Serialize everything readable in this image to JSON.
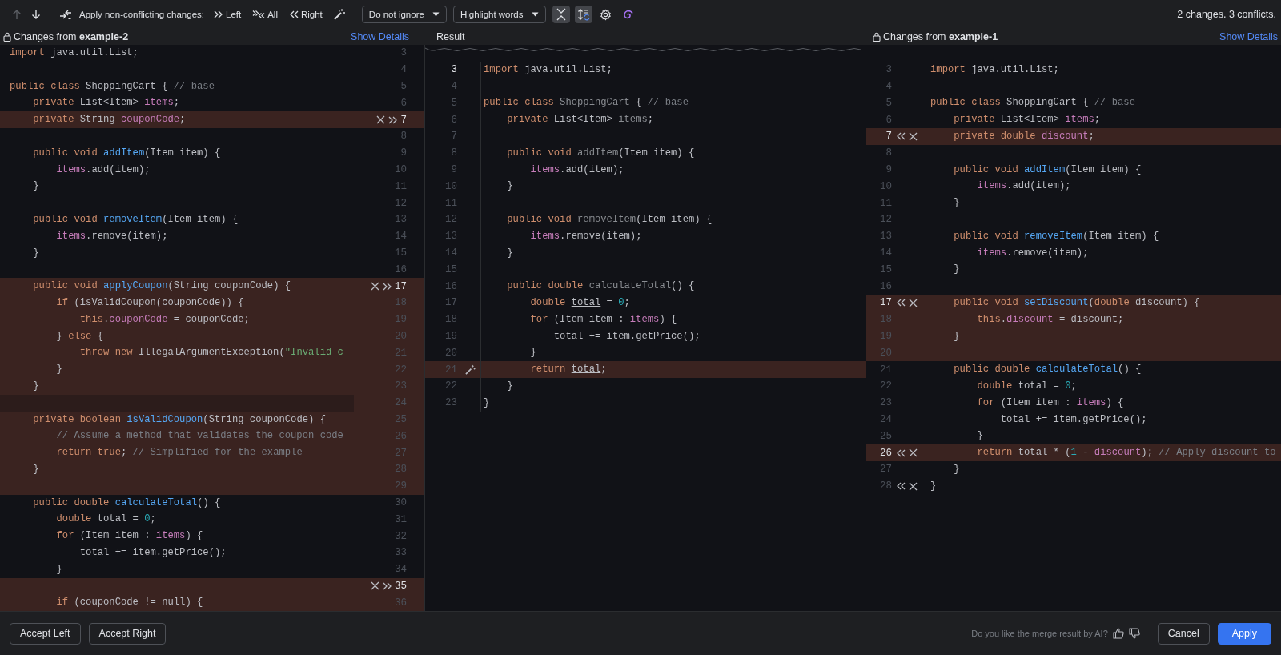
{
  "toolbar": {
    "nav": [
      {
        "kind": "up",
        "disabled": true
      },
      {
        "kind": "down",
        "disabled": false
      }
    ],
    "apply_label": "Apply non-conflicting changes:",
    "apply_actions": [
      {
        "kind": "left",
        "label": "Left"
      },
      {
        "kind": "all",
        "label": "All"
      },
      {
        "kind": "right",
        "label": "Right"
      }
    ],
    "dropdowns": [
      {
        "value": "Do not ignore"
      },
      {
        "value": "Highlight words"
      }
    ],
    "toggles": [
      {
        "kind": "collapse",
        "on": true
      },
      {
        "kind": "sync",
        "on": true
      }
    ],
    "summary": "2 changes. 3 conflicts."
  },
  "left": {
    "title": "Changes from",
    "branch": "example-2",
    "details": "Show Details",
    "lines": [
      {
        "n": "3",
        "changed": false,
        "code": [
          {
            "text": "import ",
            "kind": "kw"
          },
          {
            "text": "java.util.List;",
            "kind": "p"
          }
        ]
      },
      {
        "n": "4",
        "changed": false
      },
      {
        "n": "5",
        "changed": false,
        "code": [
          {
            "text": "public class ",
            "kind": "kw"
          },
          {
            "text": "ShoppingCart { ",
            "kind": "p"
          },
          {
            "text": "// base",
            "kind": "c"
          }
        ]
      },
      {
        "n": "6",
        "changed": false,
        "code": [
          {
            "text": "    private ",
            "kind": "kw"
          },
          {
            "text": "List<Item> ",
            "kind": "p"
          },
          {
            "text": "items",
            "kind": "f"
          },
          {
            "text": ";",
            "kind": "p"
          }
        ]
      },
      {
        "n": "7",
        "changed": true,
        "kind": "actions",
        "code": [
          {
            "text": "    private ",
            "kind": "kw"
          },
          {
            "text": "String ",
            "kind": "p"
          },
          {
            "text": "couponCode",
            "kind": "f"
          },
          {
            "text": ";",
            "kind": "p"
          }
        ]
      },
      {
        "n": "8",
        "changed": false
      },
      {
        "n": "9",
        "changed": false,
        "code": [
          {
            "text": "    public void ",
            "kind": "kw"
          },
          {
            "text": "addItem",
            "kind": "fn"
          },
          {
            "text": "(Item item) {",
            "kind": "p"
          }
        ]
      },
      {
        "n": "10",
        "changed": false,
        "code": [
          {
            "text": "        items",
            "kind": "f"
          },
          {
            "text": ".add(item);",
            "kind": "p"
          }
        ]
      },
      {
        "n": "11",
        "changed": false,
        "code": [
          {
            "text": "    }",
            "kind": "p"
          }
        ]
      },
      {
        "n": "12",
        "changed": false
      },
      {
        "n": "13",
        "changed": false,
        "code": [
          {
            "text": "    public void ",
            "kind": "kw"
          },
          {
            "text": "removeItem",
            "kind": "fn"
          },
          {
            "text": "(Item item) {",
            "kind": "p"
          }
        ]
      },
      {
        "n": "14",
        "changed": false,
        "code": [
          {
            "text": "        items",
            "kind": "f"
          },
          {
            "text": ".remove(item);",
            "kind": "p"
          }
        ]
      },
      {
        "n": "15",
        "changed": false,
        "code": [
          {
            "text": "    }",
            "kind": "p"
          }
        ]
      },
      {
        "n": "16",
        "changed": false
      },
      {
        "n": "17",
        "changed": true,
        "kind": "actions",
        "code": [
          {
            "text": "    public void ",
            "kind": "kw"
          },
          {
            "text": "applyCoupon",
            "kind": "fn"
          },
          {
            "text": "(String couponCode) {",
            "kind": "p"
          }
        ]
      },
      {
        "n": "18",
        "changed": true,
        "code": [
          {
            "text": "        if ",
            "kind": "kw"
          },
          {
            "text": "(isValidCoupon(couponCode)) {",
            "kind": "p"
          }
        ]
      },
      {
        "n": "19",
        "changed": true,
        "code": [
          {
            "text": "            this",
            "kind": "kw"
          },
          {
            "text": ".",
            "kind": "p"
          },
          {
            "text": "couponCode",
            "kind": "f"
          },
          {
            "text": " = couponCode;",
            "kind": "p"
          }
        ]
      },
      {
        "n": "20",
        "changed": true,
        "code": [
          {
            "text": "        } ",
            "kind": "p"
          },
          {
            "text": "else",
            "kind": "kw"
          },
          {
            "text": " {",
            "kind": "p"
          }
        ]
      },
      {
        "n": "21",
        "changed": true,
        "code": [
          {
            "text": "            throw new ",
            "kind": "kw"
          },
          {
            "text": "IllegalArgumentException(",
            "kind": "p"
          },
          {
            "text": "\"Invalid c",
            "kind": "s"
          }
        ]
      },
      {
        "n": "22",
        "changed": true,
        "code": [
          {
            "text": "        }",
            "kind": "p"
          }
        ]
      },
      {
        "n": "23",
        "changed": true,
        "code": [
          {
            "text": "    }",
            "kind": "p"
          }
        ]
      },
      {
        "n": "24",
        "changed": true
      },
      {
        "n": "25",
        "changed": true,
        "code": [
          {
            "text": "    private boolean ",
            "kind": "kw"
          },
          {
            "text": "isValidCoupon",
            "kind": "fn"
          },
          {
            "text": "(String couponCode) {",
            "kind": "p"
          }
        ]
      },
      {
        "n": "26",
        "changed": true,
        "code": [
          {
            "text": "        // Assume a method that validates the coupon code",
            "kind": "c"
          }
        ]
      },
      {
        "n": "27",
        "changed": true,
        "code": [
          {
            "text": "        return true",
            "kind": "kw"
          },
          {
            "text": "; ",
            "kind": "p"
          },
          {
            "text": "// Simplified for the example",
            "kind": "c"
          }
        ]
      },
      {
        "n": "28",
        "changed": true,
        "code": [
          {
            "text": "    }",
            "kind": "p"
          }
        ]
      },
      {
        "n": "29",
        "changed": true
      },
      {
        "n": "30",
        "changed": false,
        "code": [
          {
            "text": "    public double ",
            "kind": "kw"
          },
          {
            "text": "calculateTotal",
            "kind": "fn"
          },
          {
            "text": "() {",
            "kind": "p"
          }
        ]
      },
      {
        "n": "31",
        "changed": false,
        "code": [
          {
            "text": "        double ",
            "kind": "kw"
          },
          {
            "text": "total = ",
            "kind": "p"
          },
          {
            "text": "0",
            "kind": "n"
          },
          {
            "text": ";",
            "kind": "p"
          }
        ]
      },
      {
        "n": "32",
        "changed": false,
        "code": [
          {
            "text": "        for ",
            "kind": "kw"
          },
          {
            "text": "(Item item : ",
            "kind": "p"
          },
          {
            "text": "items",
            "kind": "f"
          },
          {
            "text": ") {",
            "kind": "p"
          }
        ]
      },
      {
        "n": "33",
        "changed": false,
        "code": [
          {
            "text": "            total += item.getPrice();",
            "kind": "p"
          }
        ]
      },
      {
        "n": "34",
        "changed": false,
        "code": [
          {
            "text": "        }",
            "kind": "p"
          }
        ]
      },
      {
        "n": "35",
        "changed": true,
        "kind": "actions"
      },
      {
        "n": "36",
        "changed": true,
        "code": [
          {
            "text": "        if ",
            "kind": "kw"
          },
          {
            "text": "(couponCode != null) {",
            "kind": "p"
          }
        ]
      }
    ]
  },
  "result": {
    "title": "Result",
    "lines": [
      {
        "n": "3",
        "changed": false,
        "code": [
          {
            "text": "import ",
            "kind": "kw"
          },
          {
            "text": "java.util.List;",
            "kind": "p"
          }
        ]
      },
      {
        "n": "4",
        "changed": false
      },
      {
        "n": "5",
        "changed": false,
        "code": [
          {
            "text": "public class ",
            "kind": "kw"
          },
          {
            "text": "ShoppingCart",
            "kind": "d"
          },
          {
            "text": " { ",
            "kind": "p"
          },
          {
            "text": "// base",
            "kind": "c"
          }
        ]
      },
      {
        "n": "6",
        "changed": false,
        "code": [
          {
            "text": "    private ",
            "kind": "kw"
          },
          {
            "text": "List<Item> ",
            "kind": "p"
          },
          {
            "text": "items",
            "kind": "d"
          },
          {
            "text": ";",
            "kind": "p"
          }
        ]
      },
      {
        "n": "7",
        "changed": false
      },
      {
        "n": "8",
        "changed": false,
        "code": [
          {
            "text": "    public void ",
            "kind": "kw"
          },
          {
            "text": "addItem",
            "kind": "d"
          },
          {
            "text": "(Item item) {",
            "kind": "p"
          }
        ]
      },
      {
        "n": "9",
        "changed": false,
        "code": [
          {
            "text": "        items",
            "kind": "f"
          },
          {
            "text": ".add(item);",
            "kind": "p"
          }
        ]
      },
      {
        "n": "10",
        "changed": false,
        "code": [
          {
            "text": "    }",
            "kind": "p"
          }
        ]
      },
      {
        "n": "11",
        "changed": false
      },
      {
        "n": "12",
        "changed": false,
        "code": [
          {
            "text": "    public void ",
            "kind": "kw"
          },
          {
            "text": "removeItem",
            "kind": "d"
          },
          {
            "text": "(Item item) {",
            "kind": "p"
          }
        ]
      },
      {
        "n": "13",
        "changed": false,
        "code": [
          {
            "text": "        items",
            "kind": "f"
          },
          {
            "text": ".remove(item);",
            "kind": "p"
          }
        ]
      },
      {
        "n": "14",
        "changed": false,
        "code": [
          {
            "text": "    }",
            "kind": "p"
          }
        ]
      },
      {
        "n": "15",
        "changed": false
      },
      {
        "n": "16",
        "changed": false,
        "code": [
          {
            "text": "    public double ",
            "kind": "kw"
          },
          {
            "text": "calculateTotal",
            "kind": "d"
          },
          {
            "text": "() {",
            "kind": "p"
          }
        ]
      },
      {
        "n": "17",
        "changed": false,
        "code": [
          {
            "text": "        double ",
            "kind": "kw"
          },
          {
            "text": "total",
            "kind": "u"
          },
          {
            "text": " = ",
            "kind": "p"
          },
          {
            "text": "0",
            "kind": "n"
          },
          {
            "text": ";",
            "kind": "p"
          }
        ]
      },
      {
        "n": "18",
        "changed": false,
        "code": [
          {
            "text": "        for ",
            "kind": "kw"
          },
          {
            "text": "(Item item : ",
            "kind": "p"
          },
          {
            "text": "items",
            "kind": "f"
          },
          {
            "text": ") {",
            "kind": "p"
          }
        ]
      },
      {
        "n": "19",
        "changed": false,
        "code": [
          {
            "text": "            total",
            "kind": "u"
          },
          {
            "text": " += item.getPrice();",
            "kind": "p"
          }
        ]
      },
      {
        "n": "20",
        "changed": false,
        "code": [
          {
            "text": "        }",
            "kind": "p"
          }
        ]
      },
      {
        "n": "21",
        "changed": true,
        "kind": "wand",
        "code": [
          {
            "text": "        return ",
            "kind": "kw"
          },
          {
            "text": "total",
            "kind": "u"
          },
          {
            "text": ";",
            "kind": "p"
          }
        ]
      },
      {
        "n": "22",
        "changed": false,
        "code": [
          {
            "text": "    }",
            "kind": "p"
          }
        ]
      },
      {
        "n": "23",
        "changed": false,
        "code": [
          {
            "text": "}",
            "kind": "p"
          }
        ]
      }
    ]
  },
  "right": {
    "title": "Changes from",
    "branch": "example-1",
    "details": "Show Details",
    "lines": [
      {
        "n": "3",
        "changed": false,
        "code": [
          {
            "text": "import ",
            "kind": "kw"
          },
          {
            "text": "java.util.List;",
            "kind": "p"
          }
        ]
      },
      {
        "n": "4",
        "changed": false
      },
      {
        "n": "5",
        "changed": false,
        "code": [
          {
            "text": "public class ",
            "kind": "kw"
          },
          {
            "text": "ShoppingCart { ",
            "kind": "p"
          },
          {
            "text": "// base",
            "kind": "c"
          }
        ]
      },
      {
        "n": "6",
        "changed": false,
        "code": [
          {
            "text": "    private ",
            "kind": "kw"
          },
          {
            "text": "List<Item> ",
            "kind": "p"
          },
          {
            "text": "items",
            "kind": "f"
          },
          {
            "text": ";",
            "kind": "p"
          }
        ]
      },
      {
        "n": "7",
        "changed": true,
        "kind": "actions",
        "code": [
          {
            "text": "    private double ",
            "kind": "kw"
          },
          {
            "text": "discount",
            "kind": "f"
          },
          {
            "text": ";",
            "kind": "p"
          }
        ]
      },
      {
        "n": "8",
        "changed": false
      },
      {
        "n": "9",
        "changed": false,
        "code": [
          {
            "text": "    public void ",
            "kind": "kw"
          },
          {
            "text": "addItem",
            "kind": "fn"
          },
          {
            "text": "(Item item) {",
            "kind": "p"
          }
        ]
      },
      {
        "n": "10",
        "changed": false,
        "code": [
          {
            "text": "        items",
            "kind": "f"
          },
          {
            "text": ".add(item);",
            "kind": "p"
          }
        ]
      },
      {
        "n": "11",
        "changed": false,
        "code": [
          {
            "text": "    }",
            "kind": "p"
          }
        ]
      },
      {
        "n": "12",
        "changed": false
      },
      {
        "n": "13",
        "changed": false,
        "code": [
          {
            "text": "    public void ",
            "kind": "kw"
          },
          {
            "text": "removeItem",
            "kind": "fn"
          },
          {
            "text": "(Item item) {",
            "kind": "p"
          }
        ]
      },
      {
        "n": "14",
        "changed": false,
        "code": [
          {
            "text": "        items",
            "kind": "f"
          },
          {
            "text": ".remove(item);",
            "kind": "p"
          }
        ]
      },
      {
        "n": "15",
        "changed": false,
        "code": [
          {
            "text": "    }",
            "kind": "p"
          }
        ]
      },
      {
        "n": "16",
        "changed": false
      },
      {
        "n": "17",
        "changed": true,
        "kind": "actions",
        "code": [
          {
            "text": "    public void ",
            "kind": "kw"
          },
          {
            "text": "setDiscount",
            "kind": "fn"
          },
          {
            "text": "(",
            "kind": "p"
          },
          {
            "text": "double ",
            "kind": "kw"
          },
          {
            "text": "discount) {",
            "kind": "p"
          }
        ]
      },
      {
        "n": "18",
        "changed": true,
        "code": [
          {
            "text": "        this",
            "kind": "kw"
          },
          {
            "text": ".",
            "kind": "p"
          },
          {
            "text": "discount",
            "kind": "f"
          },
          {
            "text": " = discount;",
            "kind": "p"
          }
        ]
      },
      {
        "n": "19",
        "changed": true,
        "code": [
          {
            "text": "    }",
            "kind": "p"
          }
        ]
      },
      {
        "n": "20",
        "changed": true
      },
      {
        "n": "21",
        "changed": false,
        "code": [
          {
            "text": "    public double ",
            "kind": "kw"
          },
          {
            "text": "calculateTotal",
            "kind": "fn"
          },
          {
            "text": "() {",
            "kind": "p"
          }
        ]
      },
      {
        "n": "22",
        "changed": false,
        "code": [
          {
            "text": "        double ",
            "kind": "kw"
          },
          {
            "text": "total = ",
            "kind": "p"
          },
          {
            "text": "0",
            "kind": "n"
          },
          {
            "text": ";",
            "kind": "p"
          }
        ]
      },
      {
        "n": "23",
        "changed": false,
        "code": [
          {
            "text": "        for ",
            "kind": "kw"
          },
          {
            "text": "(Item item : ",
            "kind": "p"
          },
          {
            "text": "items",
            "kind": "f"
          },
          {
            "text": ") {",
            "kind": "p"
          }
        ]
      },
      {
        "n": "24",
        "changed": false,
        "code": [
          {
            "text": "            total += item.getPrice();",
            "kind": "p"
          }
        ]
      },
      {
        "n": "25",
        "changed": false,
        "code": [
          {
            "text": "        }",
            "kind": "p"
          }
        ]
      },
      {
        "n": "26",
        "changed": true,
        "kind": "actions",
        "code": [
          {
            "text": "        return ",
            "kind": "kw"
          },
          {
            "text": "total * (",
            "kind": "p"
          },
          {
            "text": "1",
            "kind": "n"
          },
          {
            "text": " - ",
            "kind": "p"
          },
          {
            "text": "discount",
            "kind": "f"
          },
          {
            "text": "); ",
            "kind": "p"
          },
          {
            "text": "// Apply discount to",
            "kind": "c"
          }
        ]
      },
      {
        "n": "27",
        "changed": false,
        "code": [
          {
            "text": "    }",
            "kind": "p"
          }
        ]
      },
      {
        "n": "28",
        "changed": false,
        "kind": "actions",
        "code": [
          {
            "text": "}",
            "kind": "p"
          }
        ]
      }
    ]
  },
  "footer": {
    "accept_buttons": [
      "Accept Left",
      "Accept Right"
    ],
    "feedback": "Do you like the merge result by AI?",
    "cancel": "Cancel",
    "apply": "Apply"
  }
}
